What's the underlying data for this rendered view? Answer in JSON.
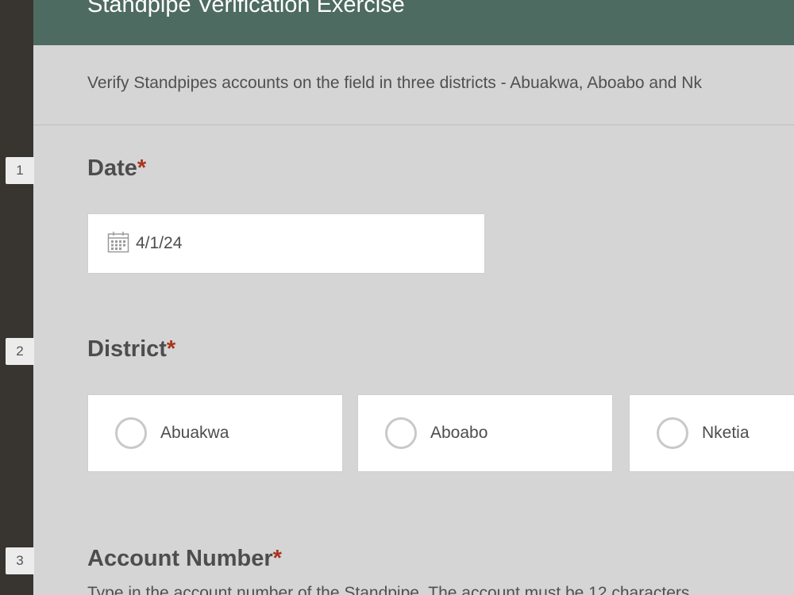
{
  "form": {
    "title": "Standpipe Verification Exercise",
    "description": "Verify Standpipes accounts on the field in three districts - Abuakwa, Aboabo and Nk"
  },
  "questions": [
    {
      "index": "1",
      "label": "Date",
      "required_mark": "*",
      "value": "4/1/24",
      "icon": "calendar-icon"
    },
    {
      "index": "2",
      "label": "District",
      "required_mark": "*",
      "options": [
        "Abuakwa",
        "Aboabo",
        "Nketia"
      ]
    },
    {
      "index": "3",
      "label": "Account Number",
      "required_mark": "*",
      "hint": "Type in the account number of the Standpipe. The account must be 12 characters"
    }
  ],
  "colors": {
    "header": "#4e6b62",
    "left_rail": "#38342f",
    "background": "#d5d5d5",
    "required": "#a8341d"
  }
}
